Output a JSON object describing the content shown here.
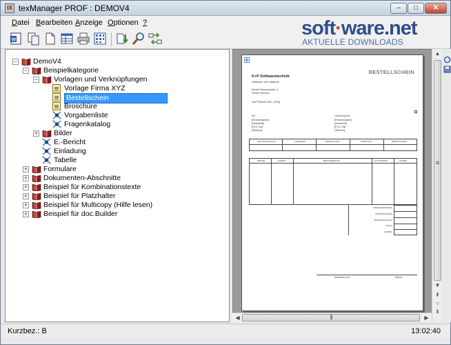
{
  "window": {
    "title": "texManager PROF : DEMOV4",
    "app_icon": "tX",
    "buttons": {
      "minimize": "‒",
      "maximize": "□",
      "close": "✕"
    }
  },
  "menu": [
    {
      "label": "Datei",
      "u": "D",
      "rest": "atei"
    },
    {
      "label": "Bearbeiten",
      "u": "B",
      "rest": "earbeiten"
    },
    {
      "label": "Anzeige",
      "u": "A",
      "rest": "nzeige"
    },
    {
      "label": "Optionen",
      "u": "O",
      "rest": "ptionen"
    },
    {
      "label": "?",
      "u": "?",
      "rest": ""
    }
  ],
  "toolbar_icons": [
    "word-icon",
    "copy-icon",
    "new-document-icon",
    "table-icon",
    "print-icon",
    "grid-icon",
    "import-icon",
    "search-icon",
    "sync-icon"
  ],
  "watermark": {
    "logo_part1": "soft",
    "logo_sep": "·",
    "logo_part2": "ware",
    "logo_tld": ".net",
    "subtitle": "AKTUELLE DOWNLOADS"
  },
  "tree": [
    {
      "label": "DemoV4",
      "level": 0,
      "icon": "book",
      "expander": "−"
    },
    {
      "label": "Beispielkategorie",
      "level": 1,
      "icon": "book",
      "expander": "−"
    },
    {
      "label": "Vorlagen und Verknüpfungen",
      "level": 2,
      "icon": "book",
      "expander": "−"
    },
    {
      "label": "Vorlage Firma XYZ",
      "level": 3,
      "icon": "doc",
      "expander": ""
    },
    {
      "label": "Bestellschein",
      "level": 3,
      "icon": "doc",
      "expander": "",
      "selected": true
    },
    {
      "label": "Broschüre",
      "level": 3,
      "icon": "doc",
      "expander": ""
    },
    {
      "label": "Vorgabenliste",
      "level": 3,
      "icon": "net",
      "expander": ""
    },
    {
      "label": "Fragenkatalog",
      "level": 3,
      "icon": "net",
      "expander": ""
    },
    {
      "label": "Bilder",
      "level": 2,
      "icon": "book",
      "expander": "+"
    },
    {
      "label": "E.-Bericht",
      "level": 2,
      "icon": "net",
      "expander": ""
    },
    {
      "label": "Einladung",
      "level": 2,
      "icon": "net",
      "expander": ""
    },
    {
      "label": "Tabelle",
      "level": 2,
      "icon": "net",
      "expander": ""
    },
    {
      "label": "Formulare",
      "level": 1,
      "icon": "book",
      "expander": "+"
    },
    {
      "label": "Dokumenten-Abschnitte",
      "level": 1,
      "icon": "book",
      "expander": "+"
    },
    {
      "label": "Beispiel für Kombinationstexte",
      "level": 1,
      "icon": "book",
      "expander": "+"
    },
    {
      "label": "Beispiel für Platzhalter",
      "level": 1,
      "icon": "book",
      "expander": "+"
    },
    {
      "label": "Beispiel für Multicopy (Hilfe lesen)",
      "level": 1,
      "icon": "book",
      "expander": "+"
    },
    {
      "label": "Beispiel für doc.Builder",
      "level": 1,
      "icon": "book",
      "expander": "+"
    }
  ],
  "preview": {
    "doc_title": "BESTELLSCHEIN",
    "company": "K+P Softwaretechnik",
    "company_sub": "Software, die mitdenkt",
    "address1": "Kleine Mauerstraße 1",
    "address2": "32052 Herford",
    "order_no": "AUFTRAGS-NR.: [000]",
    "left_block_header": "An",
    "left_block": [
      "[Firmenname]",
      "[Anschrift]",
      "[PLZ Ort]",
      "[Telefon]"
    ],
    "right_block_header": "Lieferung an",
    "right_block": [
      "[Firmenname]",
      "[Anschrift]",
      "[PLZ Ort]",
      "[Telefon]"
    ],
    "table1_headers": [
      "AUFTRAGSDATUM",
      "LIEFERART",
      "VERSAND PER",
      "FOB-PUNKT",
      "BEDINGUNGEN"
    ],
    "table2_headers": [
      "MENGE",
      "EINHEIT",
      "BESCHREIBUNG",
      "STÜCKPREIS",
      "SUMME"
    ],
    "totals": [
      "ZWISCHENSUMME",
      "UMSATZSTEUER",
      "VERSANDKOSTEN",
      "SONST.",
      "SUMME"
    ],
    "sign_left": "Autorisiert von",
    "sign_right": "Datum"
  },
  "status": {
    "left": "Kurzbez.: B",
    "right": "13:02:40"
  }
}
